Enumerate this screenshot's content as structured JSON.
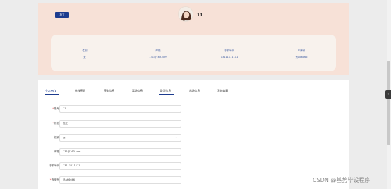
{
  "header": {
    "role_badge": "施工",
    "username": "11"
  },
  "info": [
    {
      "label": "性别",
      "value": "女"
    },
    {
      "label": "邮箱",
      "value": "131@163.com"
    },
    {
      "label": "手机号码",
      "value": "13111111111"
    },
    {
      "label": "车牌号",
      "value": "贵A66666"
    }
  ],
  "tabs": [
    {
      "label": "个人中心",
      "active": true
    },
    {
      "label": "修改密码",
      "active": false
    },
    {
      "label": "停车信息",
      "active": false
    },
    {
      "label": "离场信息",
      "active": false
    },
    {
      "label": "取消信息",
      "active": false
    },
    {
      "label": "出场信息",
      "active": false
    },
    {
      "label": "我的收藏",
      "active": false
    }
  ],
  "form": {
    "account": {
      "label": "账号",
      "value": "11"
    },
    "name": {
      "label": "姓名",
      "value": "施工"
    },
    "gender": {
      "label": "性别",
      "value": "女"
    },
    "email": {
      "label": "邮箱",
      "value": "131@163.com"
    },
    "phone": {
      "label": "手机号码",
      "value": "13111111111"
    },
    "plate": {
      "label": "车牌号",
      "value": "贵A66666"
    }
  },
  "watermark": "CSDN @基势毕设程序",
  "colors": {
    "accent": "#1d3c8f",
    "header_bg": "#f7e1d7",
    "required": "#e04b4b"
  }
}
